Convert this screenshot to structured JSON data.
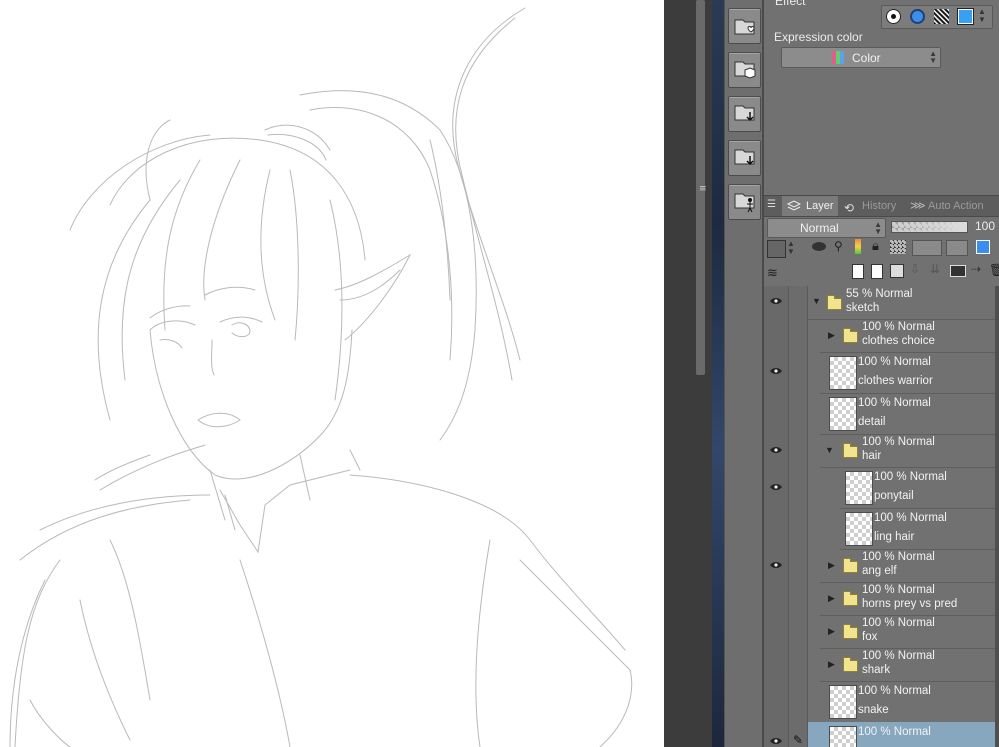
{
  "panel": {
    "effect_label": "Effect",
    "expression_color_label": "Expression color",
    "expression_color_value": "Color",
    "effect_options": [
      "black-white-icon",
      "blue-circle-icon",
      "checker-icon",
      "blue-square-icon"
    ]
  },
  "tabs": [
    {
      "label": "Layer"
    },
    {
      "label": "History"
    },
    {
      "label": "Auto Action"
    }
  ],
  "layer_controls": {
    "blend_mode": "Normal",
    "opacity": "100"
  },
  "layers": [
    {
      "opacity_mode": "55 % Normal",
      "name": "sketch",
      "kind": "folder-open",
      "visible": true
    },
    {
      "opacity_mode": "100 % Normal",
      "name": "clothes choice",
      "kind": "folder-closed",
      "visible": false
    },
    {
      "opacity_mode": "100 % Normal",
      "name": "clothes warrior",
      "kind": "raster",
      "visible": true
    },
    {
      "opacity_mode": "100 % Normal",
      "name": "detail",
      "kind": "raster",
      "visible": false
    },
    {
      "opacity_mode": "100 % Normal",
      "name": "hair",
      "kind": "folder-open",
      "visible": true
    },
    {
      "opacity_mode": "100 % Normal",
      "name": "ponytail",
      "kind": "raster",
      "visible": true
    },
    {
      "opacity_mode": "100 % Normal",
      "name": "ling hair",
      "kind": "raster",
      "visible": false
    },
    {
      "opacity_mode": "100 % Normal",
      "name": "ang elf",
      "kind": "folder-closed",
      "visible": true
    },
    {
      "opacity_mode": "100 % Normal",
      "name": "horns prey vs pred",
      "kind": "folder-closed",
      "visible": false
    },
    {
      "opacity_mode": "100 % Normal",
      "name": "fox",
      "kind": "folder-closed",
      "visible": false
    },
    {
      "opacity_mode": "100 % Normal",
      "name": "shark",
      "kind": "folder-closed",
      "visible": false
    },
    {
      "opacity_mode": "100 % Normal",
      "name": "snake",
      "kind": "raster",
      "visible": false
    },
    {
      "opacity_mode": "100 % Normal",
      "name": "",
      "kind": "raster",
      "visible": true,
      "selected": true
    }
  ],
  "colors": {
    "panel_bg": "#717171",
    "selected_row": "#87a7bf",
    "folder": "#f2e48f",
    "canvas": "#ffffff"
  }
}
